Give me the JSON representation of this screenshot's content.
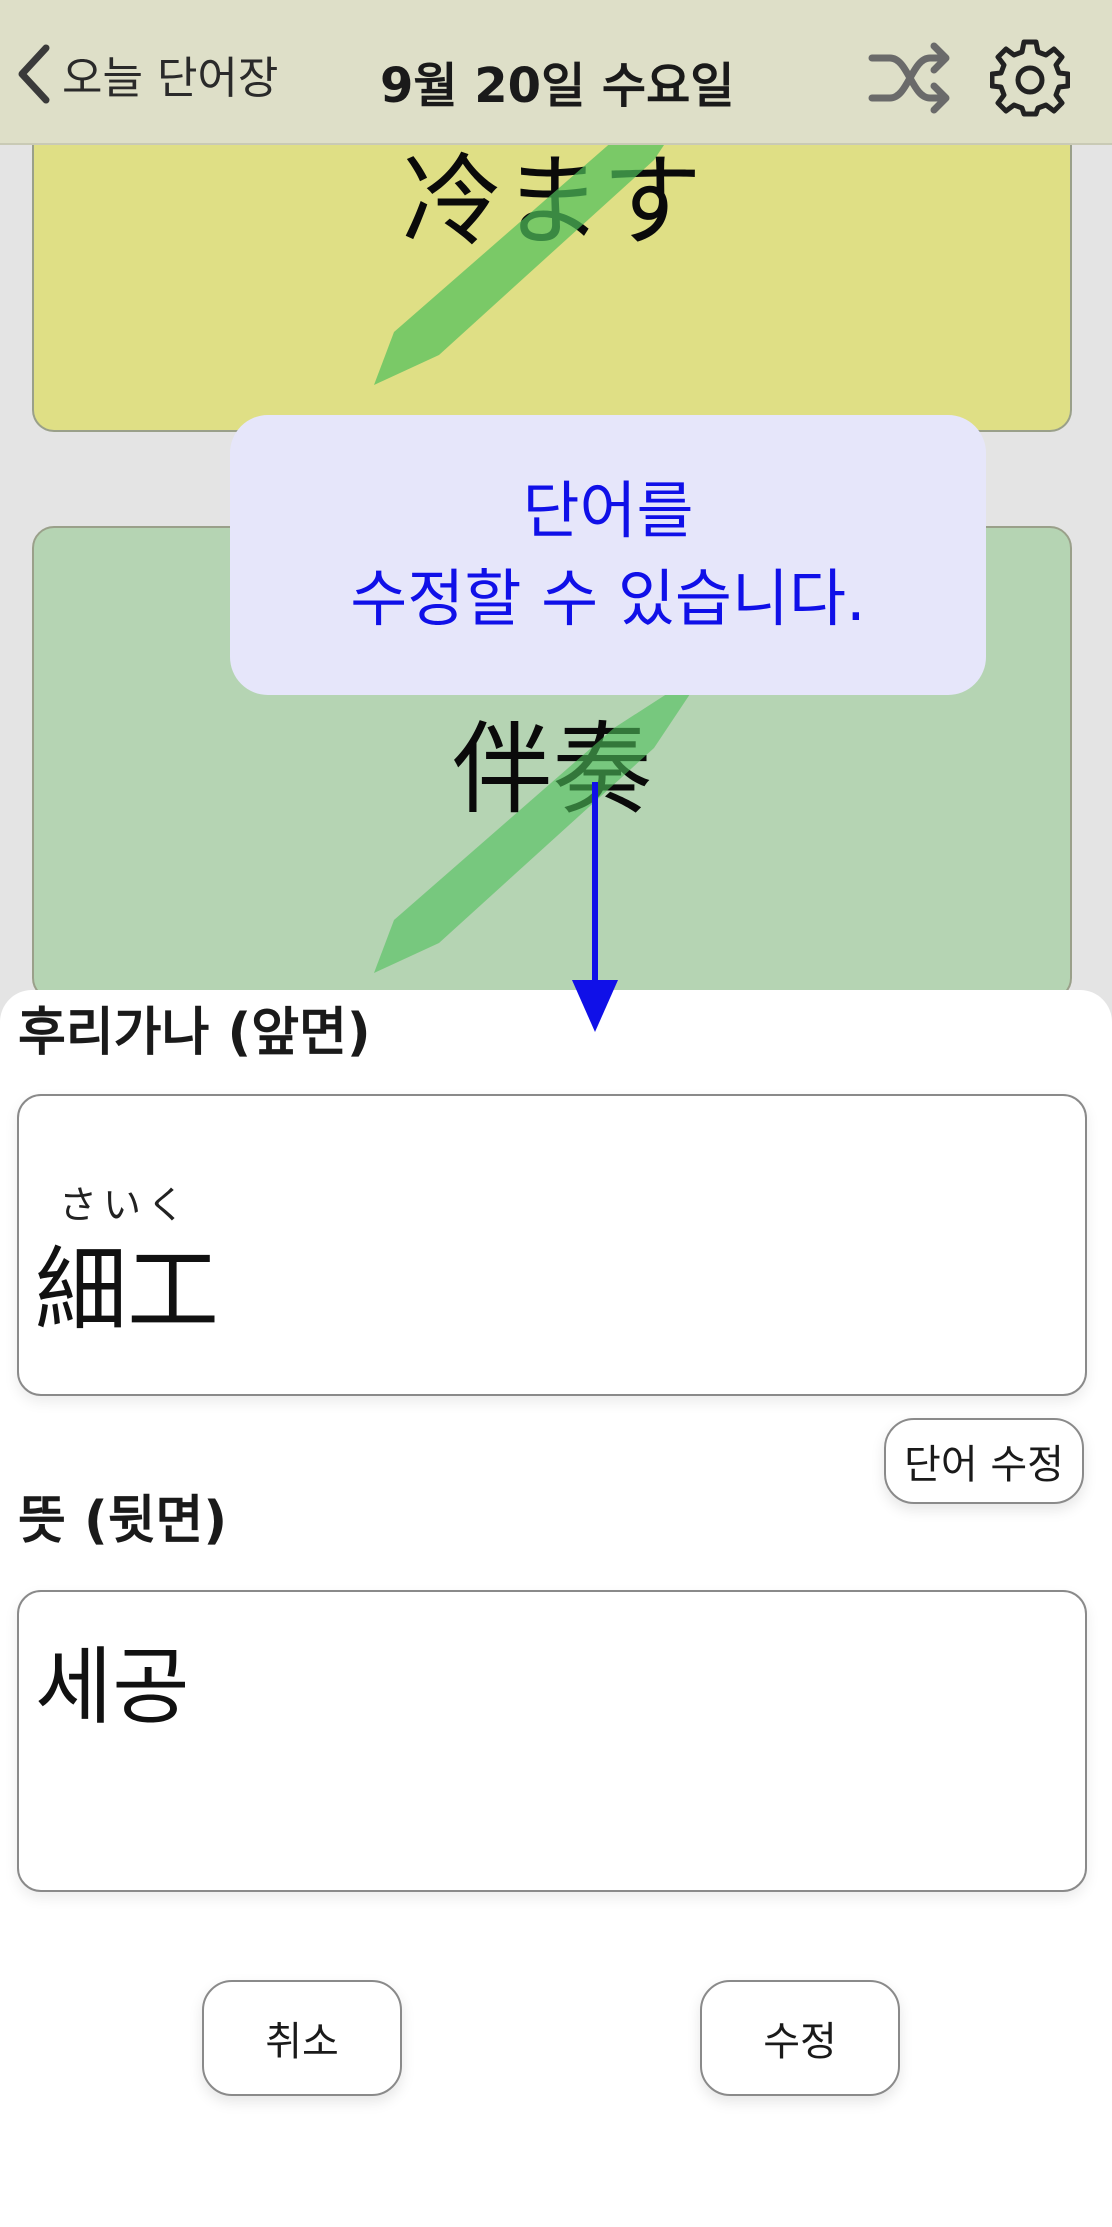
{
  "navbar": {
    "back_label": "오늘 단어장",
    "title": "9월 20일 수요일",
    "icons": [
      "chevron-left-icon",
      "shuffle-icon",
      "gear-icon"
    ]
  },
  "cards": [
    {
      "word": "冷ます",
      "color": "#dfdf85"
    },
    {
      "word": "伴奏",
      "color": "#b5d4b3"
    }
  ],
  "tooltip": {
    "line1": "단어를",
    "line2": "수정할 수 있습니다.",
    "color": "#1010e8"
  },
  "edit_sheet": {
    "front_label": "후리가나 (앞면)",
    "front_reading": "さいく",
    "front_word": "細工",
    "edit_word_button": "단어 수정",
    "back_label": "뜻 (뒷면)",
    "back_meaning": "세공",
    "cancel_button": "취소",
    "submit_button": "수정"
  }
}
